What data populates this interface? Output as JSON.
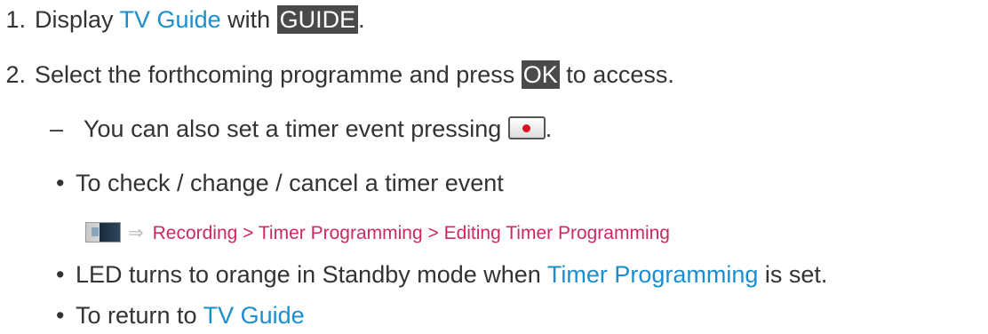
{
  "steps": [
    {
      "number": "1.",
      "text_before": "Display ",
      "link": "TV Guide",
      "text_middle": " with ",
      "key": "GUIDE",
      "text_after": "."
    },
    {
      "number": "2.",
      "text_before": "Select the forthcoming programme and press ",
      "key": "OK",
      "text_after": " to access."
    }
  ],
  "dash_note": {
    "dash": "–",
    "text": "You can also set a timer event pressing ",
    "button_icon": "record-button-icon",
    "after": "."
  },
  "bullets": {
    "symbol": "•",
    "check": "To check / change / cancel a timer event",
    "led_before": "LED turns to orange in Standby mode when ",
    "led_link": "Timer Programming",
    "led_after": " is set.",
    "return_before": "To return to ",
    "return_link": "TV Guide"
  },
  "menu_path": {
    "icon": "menu-icon",
    "arrow": "⇒",
    "path": "Recording > Timer Programming > Editing Timer Programming"
  },
  "colors": {
    "text": "#333333",
    "link": "#1a8fd0",
    "path": "#cc2a5c",
    "key_bg": "#4a4a4a",
    "record_dot": "#e0101e"
  }
}
